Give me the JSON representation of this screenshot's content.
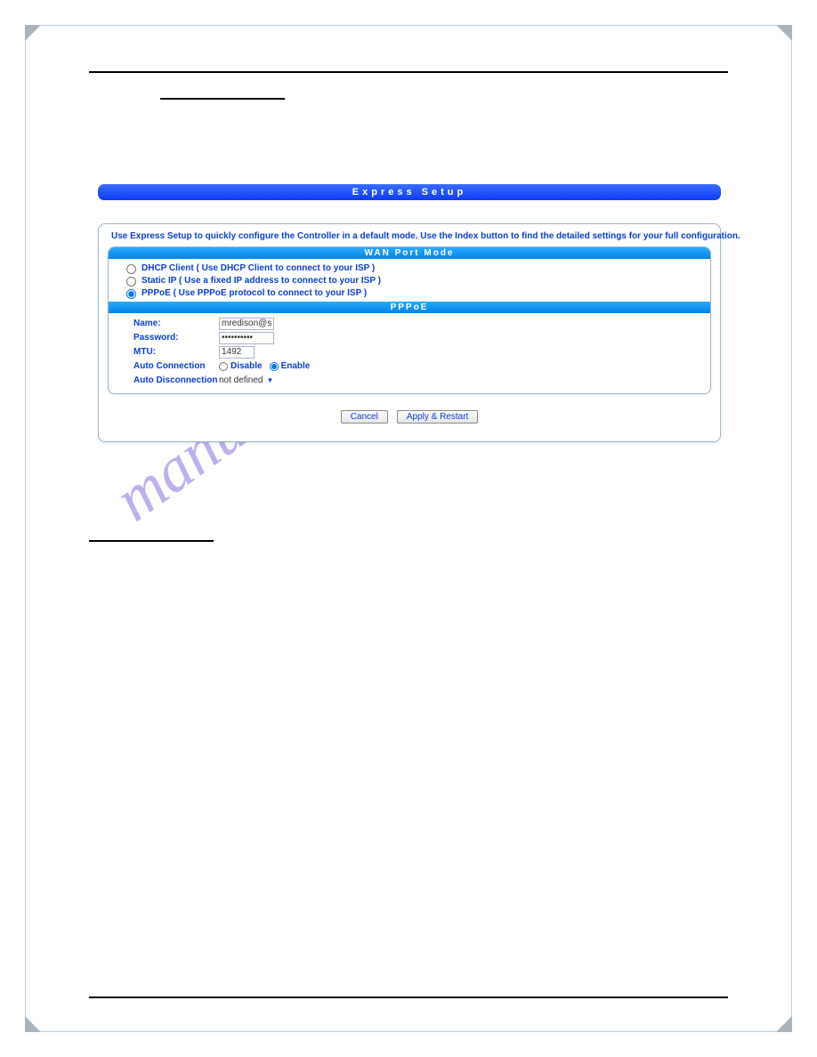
{
  "header": {
    "banner_title": "Express Setup",
    "instruction": "Use Express Setup to quickly configure the Controller in a default mode. Use the Index button to find the detailed settings for your full configuration."
  },
  "wan": {
    "section_title": "WAN Port Mode",
    "options": [
      "DHCP Client ( Use DHCP Client to connect to your ISP )",
      "Static IP ( Use a fixed IP address to connect to your ISP )",
      "PPPoE ( Use PPPoE protocol to connect to your ISP )"
    ],
    "selected_index": 2
  },
  "pppoe": {
    "section_title": "PPPoE",
    "labels": {
      "name": "Name:",
      "password": "Password:",
      "mtu": "MTU:",
      "auto_conn": "Auto Connection",
      "auto_disc": "Auto Disconnection"
    },
    "values": {
      "name": "mredison@sbcglo",
      "password": "••••••••••",
      "mtu": "1492",
      "auto_conn_disable": "Disable",
      "auto_conn_enable": "Enable",
      "auto_conn_selected": "enable",
      "auto_disc": "not defined"
    }
  },
  "buttons": {
    "cancel": "Cancel",
    "apply": "Apply & Restart"
  },
  "watermark": "manualshive.com"
}
